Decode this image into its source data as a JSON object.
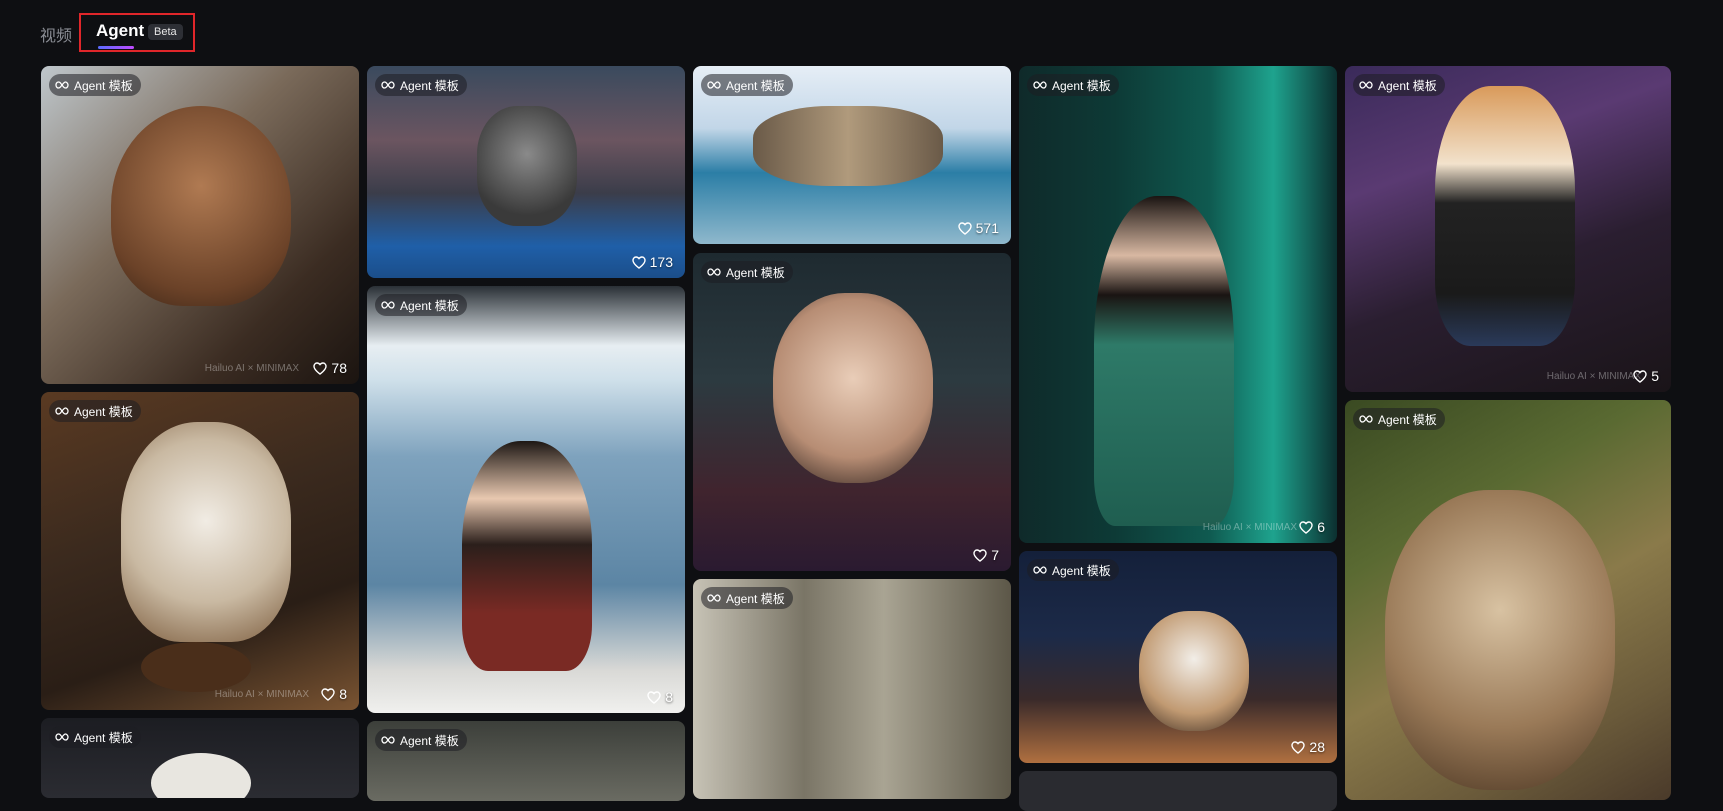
{
  "tabs": {
    "video_label": "视频",
    "agent_label": "Agent",
    "beta_badge": "Beta"
  },
  "card_tag": "Agent 模板",
  "cards": [
    {
      "likes": "78",
      "watermark": "Hailuo AI × MINIMAX"
    },
    {
      "likes": "173",
      "watermark": ""
    },
    {
      "likes": "571",
      "watermark": ""
    },
    {
      "likes": "6",
      "watermark": "Hailuo AI × MINIMAX"
    },
    {
      "likes": "5",
      "watermark": "Hailuo AI × MINIMAX"
    },
    {
      "likes": "8",
      "watermark": "Hailuo AI × MINIMAX"
    },
    {
      "likes": "8",
      "watermark": ""
    },
    {
      "likes": "7",
      "watermark": ""
    },
    {
      "likes": "28",
      "watermark": ""
    },
    {
      "likes": "",
      "watermark": ""
    },
    {
      "likes": "",
      "watermark": ""
    },
    {
      "likes": "",
      "watermark": ""
    },
    {
      "likes": "",
      "watermark": ""
    }
  ],
  "colors": {
    "background": "#0e0f12",
    "highlight_box": "#e0262a",
    "tab_active": "#ffffff",
    "tab_inactive": "#8a8d94"
  },
  "icons": {
    "tag": "infinity-loop-icon",
    "likes": "heart-outline-icon"
  }
}
